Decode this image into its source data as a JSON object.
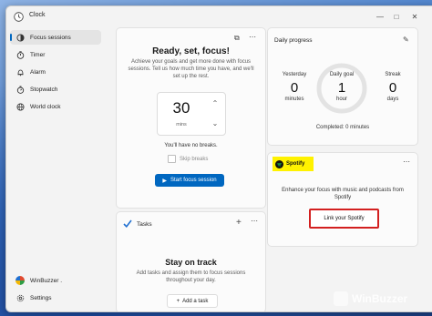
{
  "window": {
    "title": "Clock"
  },
  "sidebar": {
    "items": [
      {
        "label": "Focus sessions",
        "icon": "focus-icon",
        "active": true
      },
      {
        "label": "Timer",
        "icon": "hourglass-icon"
      },
      {
        "label": "Alarm",
        "icon": "alarm-icon"
      },
      {
        "label": "Stopwatch",
        "icon": "stopwatch-icon"
      },
      {
        "label": "World clock",
        "icon": "globe-icon"
      }
    ],
    "user": "WinBuzzer .",
    "settings": "Settings"
  },
  "focus": {
    "title": "Ready, set, focus!",
    "description": "Achieve your goals and get more done with focus sessions. Tell us how much time you have, and we'll set up the rest.",
    "timer_value": "30",
    "timer_unit": "mins",
    "breaks_text": "You'll have no breaks.",
    "skip_breaks": "Skip breaks",
    "start_button": "Start focus session"
  },
  "tasks": {
    "title": "Tasks",
    "heading": "Stay on track",
    "description": "Add tasks and assign them to focus sessions throughout your day.",
    "add_button": "Add a task"
  },
  "progress": {
    "title": "Daily progress",
    "yesterday": {
      "label": "Yesterday",
      "value": "0",
      "unit": "minutes"
    },
    "daily_goal": {
      "label": "Daily goal",
      "value": "1",
      "unit": "hour"
    },
    "streak": {
      "label": "Streak",
      "value": "0",
      "unit": "days"
    },
    "completed": "Completed: 0 minutes"
  },
  "spotify": {
    "logo_text": "Spotify",
    "description": "Enhance your focus with music and podcasts from Spotify",
    "link_button": "Link your Spotify"
  },
  "watermark": "WinBuzzer",
  "colors": {
    "accent": "#0067c0",
    "highlight": "#fff200",
    "annotation": "#d32020"
  }
}
